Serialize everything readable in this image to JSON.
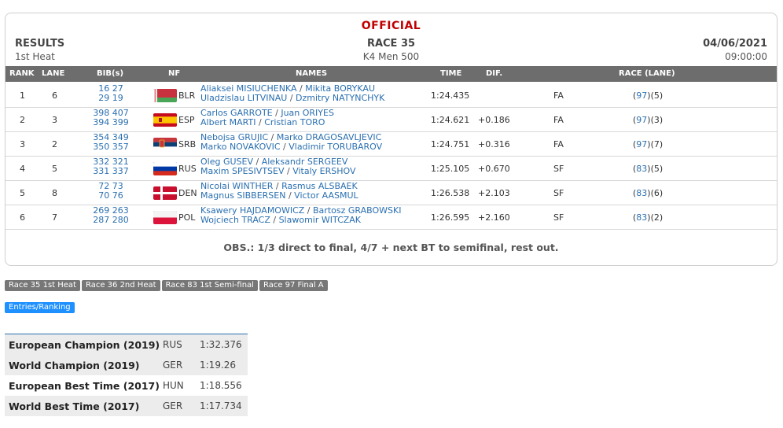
{
  "header": {
    "official": "OFFICIAL",
    "results_label": "RESULTS",
    "heat": "1st Heat",
    "race": "RACE 35",
    "event": "K4 Men 500",
    "date": "04/06/2021",
    "time": "09:00:00"
  },
  "columns": {
    "rank": "RANK",
    "lane": "LANE",
    "bib": "BIB(s)",
    "nf": "NF",
    "names": "NAMES",
    "time": "TIME",
    "dif": "DIF.",
    "race_lane": "RACE (LANE)"
  },
  "rows": [
    {
      "rank": "1",
      "lane": "6",
      "bib1": "16 27",
      "bib2": "29 19",
      "nf": "BLR",
      "flag": "blr",
      "n1": "Aliaksei MISIUCHENKA",
      "n2": "Mikita BORYKAU",
      "n3": "Uladzislau LITVINAU",
      "n4": "Dzmitry NATYNCHYK",
      "time": "1:24.435",
      "dif": "",
      "qual": "FA",
      "race_no": "97",
      "race_lane": "(5)"
    },
    {
      "rank": "2",
      "lane": "3",
      "bib1": "398 407",
      "bib2": "394 399",
      "nf": "ESP",
      "flag": "esp",
      "n1": "Carlos GARROTE",
      "n2": "Juan ORIYES",
      "n3": "Albert MARTI",
      "n4": "Cristian TORO",
      "time": "1:24.621",
      "dif": "+0.186",
      "qual": "FA",
      "race_no": "97",
      "race_lane": "(3)"
    },
    {
      "rank": "3",
      "lane": "2",
      "bib1": "354 349",
      "bib2": "350 357",
      "nf": "SRB",
      "flag": "srb",
      "n1": "Nebojsa GRUJIC",
      "n2": "Marko DRAGOSAVLJEVIC",
      "n3": "Marko NOVAKOVIC",
      "n4": "Vladimir TORUBAROV",
      "time": "1:24.751",
      "dif": "+0.316",
      "qual": "FA",
      "race_no": "97",
      "race_lane": "(7)"
    },
    {
      "rank": "4",
      "lane": "5",
      "bib1": "332 321",
      "bib2": "331 337",
      "nf": "RUS",
      "flag": "rus",
      "n1": "Oleg GUSEV",
      "n2": "Aleksandr SERGEEV",
      "n3": "Maxim SPESIVTSEV",
      "n4": "Vitaly ERSHOV",
      "time": "1:25.105",
      "dif": "+0.670",
      "qual": "SF",
      "race_no": "83",
      "race_lane": "(5)"
    },
    {
      "rank": "5",
      "lane": "8",
      "bib1": "72 73",
      "bib2": "70 76",
      "nf": "DEN",
      "flag": "den",
      "n1": "Nicolai WINTHER",
      "n2": "Rasmus ALSBAEK",
      "n3": "Magnus SIBBERSEN",
      "n4": "Victor AASMUL",
      "time": "1:26.538",
      "dif": "+2.103",
      "qual": "SF",
      "race_no": "83",
      "race_lane": "(6)"
    },
    {
      "rank": "6",
      "lane": "7",
      "bib1": "269 263",
      "bib2": "287 280",
      "nf": "POL",
      "flag": "pol",
      "n1": "Ksawery HAJDAMOWICZ",
      "n2": "Bartosz GRABOWSKI",
      "n3": "Wojciech TRACZ",
      "n4": "Slawomir WITCZAK",
      "time": "1:26.595",
      "dif": "+2.160",
      "qual": "SF",
      "race_no": "83",
      "race_lane": "(2)"
    }
  ],
  "separator": " / ",
  "obs": "OBS.: 1/3 direct to final, 4/7 + next BT to semifinal, rest out.",
  "tags": [
    "Race 35 1st Heat",
    "Race 36 2nd Heat",
    "Race 83 1st Semi-final",
    "Race 97 Final A"
  ],
  "entries_ranking": "Entries/Ranking",
  "records": [
    {
      "label": "European Champion (2019)",
      "country": "RUS",
      "time": "1:32.376"
    },
    {
      "label": "World Champion (2019)",
      "country": "GER",
      "time": "1:19.26"
    },
    {
      "label": "European Best Time (2017)",
      "country": "HUN",
      "time": "1:18.556"
    },
    {
      "label": "World Best Time (2017)",
      "country": "GER",
      "time": "1:17.734"
    }
  ],
  "colors": {
    "official_red": "#c00000",
    "link_blue": "#2a6fb0",
    "header_gray": "#6d6d6d",
    "entries_blue": "#1e90ff"
  }
}
